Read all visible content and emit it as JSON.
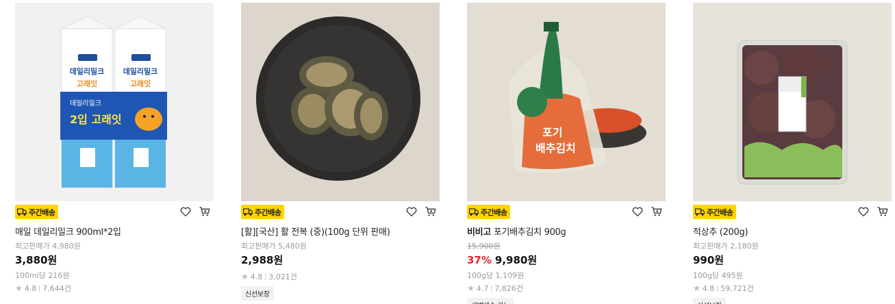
{
  "colors": {
    "badge": "#ffd400",
    "discount": "#e6242b"
  },
  "products": [
    {
      "badge": "주간배송",
      "name_brand": "",
      "name": "매일 데일리밀크 900ml*2입",
      "ref_price": "최고판매가 4,980원",
      "discount": "",
      "price": "3,880원",
      "unit_price": "100ml당 216원",
      "rating": "4.8",
      "reviews": "7,644건",
      "tag": "",
      "image": "milk-carton-photo"
    },
    {
      "badge": "주간배송",
      "name_brand": "",
      "name": "[활][국산] 활 전복 (중)(100g 단위 판매)",
      "ref_price": "최고판매가 5,480원",
      "discount": "",
      "price": "2,988원",
      "unit_price": "",
      "rating": "4.8",
      "reviews": "3,021건",
      "tag": "신선보장",
      "image": "abalone-plate-photo"
    },
    {
      "badge": "주간배송",
      "name_brand": "비비고",
      "name": " 포기배추김치 900g",
      "ref_price": "15,900원",
      "discount": "37%",
      "price": "9,980원",
      "unit_price": "100g당 1,109원",
      "rating": "4.7",
      "reviews": "7,826건",
      "tag": "새벽배송 가능",
      "image": "kimchi-bag-photo"
    },
    {
      "badge": "주간배송",
      "name_brand": "",
      "name": "적상추 (200g)",
      "ref_price": "최고판매가 2,180원",
      "discount": "",
      "price": "990원",
      "unit_price": "100g당 495원",
      "rating": "4.8",
      "reviews": "59,721건",
      "tag": "신선보장",
      "image": "red-lettuce-pack-photo"
    }
  ]
}
